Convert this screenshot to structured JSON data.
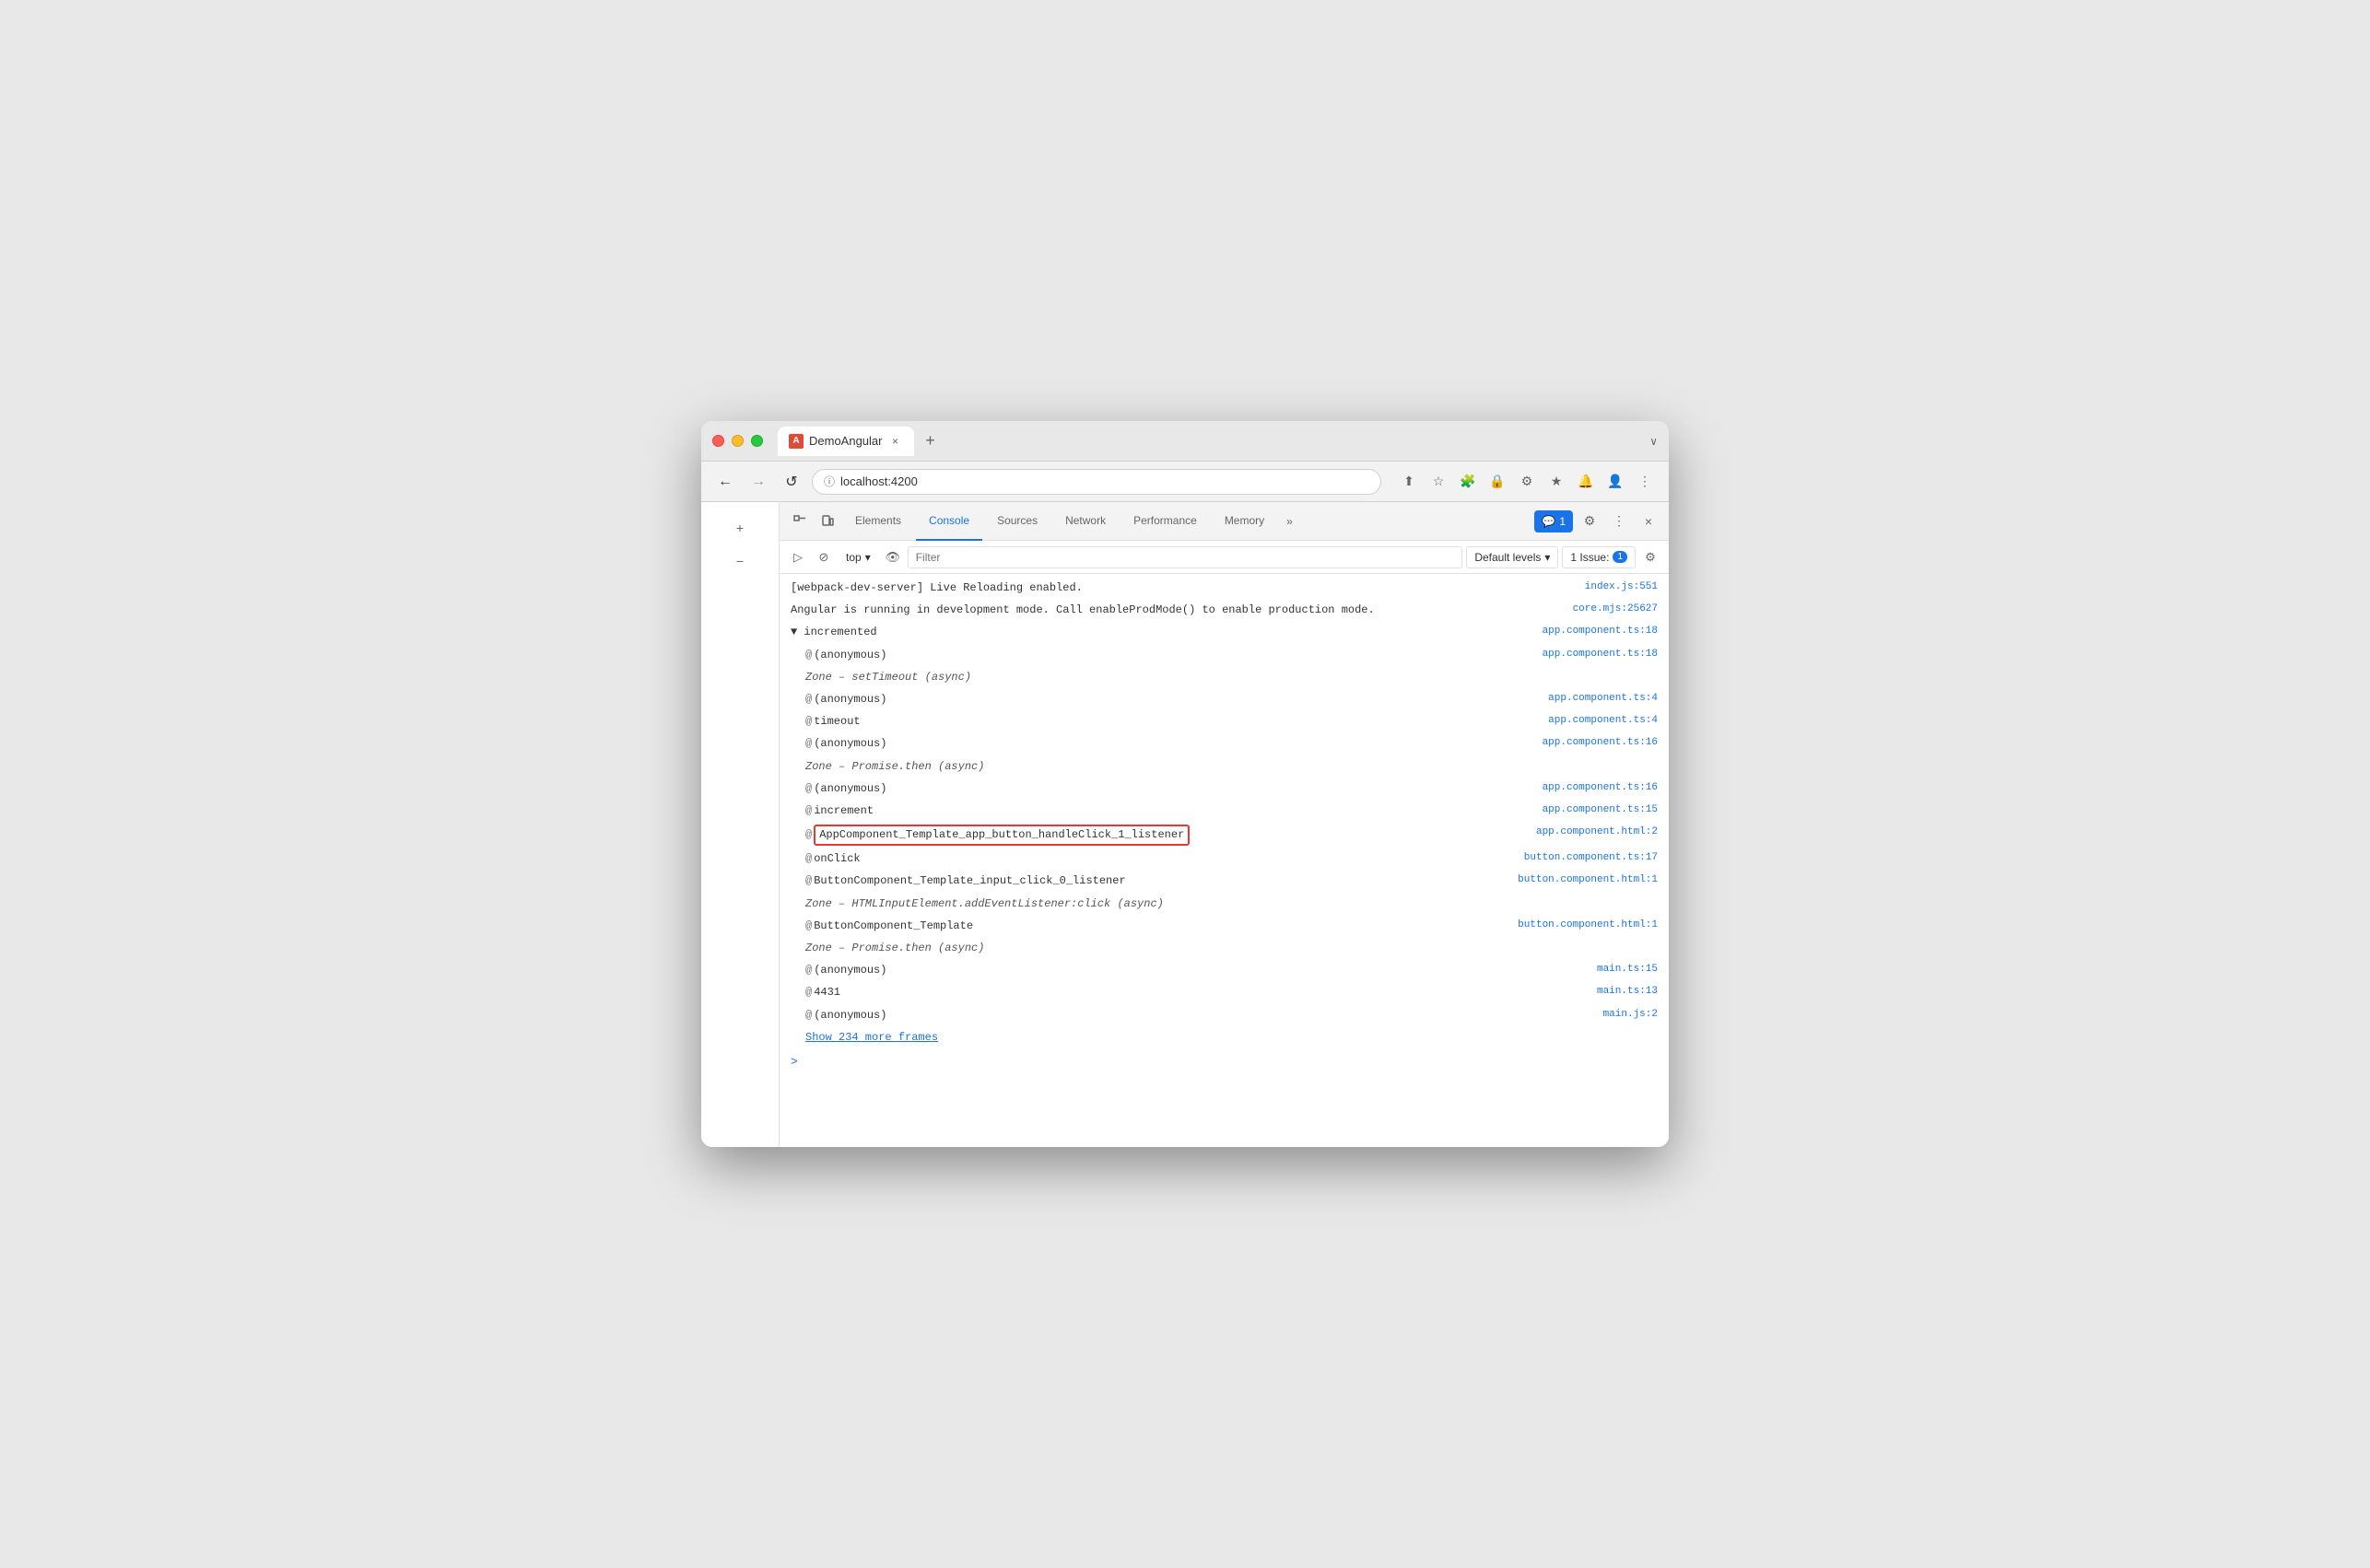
{
  "browser": {
    "tab": {
      "title": "DemoAngular",
      "favicon": "A",
      "close_label": "×",
      "new_tab_label": "+"
    },
    "expand_label": "∨",
    "nav": {
      "back_label": "←",
      "forward_label": "→",
      "reload_label": "↺",
      "address": "localhost:4200",
      "address_icon": "ⓘ"
    },
    "nav_actions": [
      "↑",
      "☆",
      "☻",
      "🔒",
      "⚙",
      "★",
      "🔔",
      "👤",
      "⋮"
    ]
  },
  "sidebar": {
    "btn1": "+",
    "btn2": "−"
  },
  "devtools": {
    "tabs": [
      {
        "label": "Elements",
        "active": false
      },
      {
        "label": "Console",
        "active": true
      },
      {
        "label": "Sources",
        "active": false
      },
      {
        "label": "Network",
        "active": false
      },
      {
        "label": "Performance",
        "active": false
      },
      {
        "label": "Memory",
        "active": false
      }
    ],
    "more_label": "»",
    "badge": {
      "icon": "💬",
      "count": "1"
    },
    "settings_icon": "⚙",
    "more_dots": "⋮",
    "close_icon": "×"
  },
  "console_toolbar": {
    "play_icon": "▷",
    "ban_icon": "⊘",
    "top_label": "top",
    "dropdown_icon": "▾",
    "eye_icon": "👁",
    "filter_placeholder": "Filter",
    "default_levels_label": "Default levels",
    "dropdown2_icon": "▾",
    "issue_label": "1 Issue:",
    "issue_count": "1",
    "settings_icon": "⚙"
  },
  "console": {
    "lines": [
      {
        "content": "[webpack-dev-server] Live Reloading enabled.",
        "source": "index.js:551",
        "source_link": true,
        "indent": 0,
        "highlighted": false
      },
      {
        "content": "Angular is running in development mode. Call enableProdMode() to enable production mode.",
        "source": "core.mjs:25627",
        "source_link": true,
        "indent": 0,
        "highlighted": false
      },
      {
        "content": "▼ incremented",
        "source": "app.component.ts:18",
        "source_link": true,
        "indent": 0,
        "highlighted": false
      },
      {
        "content": "(anonymous)",
        "source": "app.component.ts:18",
        "source_link": true,
        "indent": 1,
        "at": true,
        "highlighted": false
      },
      {
        "content": "Zone – setTimeout (async)",
        "source": "",
        "source_link": false,
        "indent": 1,
        "highlighted": false,
        "italic": true
      },
      {
        "content": "(anonymous)",
        "source": "app.component.ts:4",
        "source_link": true,
        "indent": 1,
        "at": true,
        "highlighted": false
      },
      {
        "content": "timeout",
        "source": "app.component.ts:4",
        "source_link": true,
        "indent": 1,
        "at": true,
        "highlighted": false
      },
      {
        "content": "(anonymous)",
        "source": "app.component.ts:16",
        "source_link": true,
        "indent": 1,
        "at": true,
        "highlighted": false
      },
      {
        "content": "Zone – Promise.then (async)",
        "source": "",
        "source_link": false,
        "indent": 1,
        "highlighted": false,
        "italic": true
      },
      {
        "content": "(anonymous)",
        "source": "app.component.ts:16",
        "source_link": true,
        "indent": 1,
        "at": true,
        "highlighted": false
      },
      {
        "content": "increment",
        "source": "app.component.ts:15",
        "source_link": true,
        "indent": 1,
        "at": true,
        "highlighted": false
      },
      {
        "content": "AppComponent_Template_app_button_handleClick_1_listener",
        "source": "app.component.html:2",
        "source_link": true,
        "indent": 1,
        "at": true,
        "highlighted": true
      },
      {
        "content": "onClick",
        "source": "button.component.ts:17",
        "source_link": true,
        "indent": 1,
        "at": true,
        "highlighted": false
      },
      {
        "content": "ButtonComponent_Template_input_click_0_listener",
        "source": "button.component.html:1",
        "source_link": true,
        "indent": 1,
        "at": true,
        "highlighted": false
      },
      {
        "content": "Zone – HTMLInputElement.addEventListener:click (async)",
        "source": "",
        "source_link": false,
        "indent": 1,
        "highlighted": false,
        "italic": true
      },
      {
        "content": "ButtonComponent_Template",
        "source": "button.component.html:1",
        "source_link": true,
        "indent": 1,
        "at": true,
        "highlighted": false
      },
      {
        "content": "Zone – Promise.then (async)",
        "source": "",
        "source_link": false,
        "indent": 1,
        "highlighted": false,
        "italic": true
      },
      {
        "content": "(anonymous)",
        "source": "main.ts:15",
        "source_link": true,
        "indent": 1,
        "at": true,
        "highlighted": false
      },
      {
        "content": "4431",
        "source": "main.ts:13",
        "source_link": true,
        "indent": 1,
        "at": true,
        "highlighted": false
      },
      {
        "content": "(anonymous)",
        "source": "main.js:2",
        "source_link": true,
        "indent": 1,
        "at": true,
        "highlighted": false
      }
    ],
    "show_more_label": "Show 234 more frames",
    "prompt_symbol": ">"
  }
}
